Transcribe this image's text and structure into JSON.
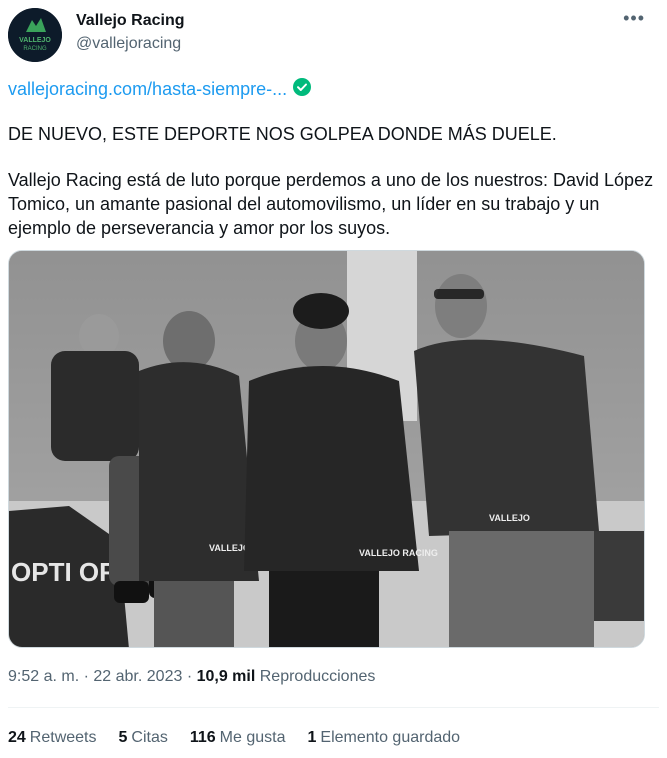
{
  "account": {
    "name": "Vallejo Racing",
    "handle": "@vallejoracing",
    "avatar_text": "VALLEJO RACING"
  },
  "tweet": {
    "link": "vallejoracing.com/hasta-siempre-...",
    "line1": "DE NUEVO, ESTE DEPORTE NOS GOLPEA DONDE MÁS DUELE.",
    "line2": "Vallejo Racing está de luto porque perdemos a uno de los nuestros: David López Tomico, un amante pasional del automovilismo, un líder en su trabajo y un ejemplo de perseverancia y amor por los suyos."
  },
  "meta": {
    "time": "9:52 a. m.",
    "date": "22 abr. 2023",
    "views_count": "10,9 mil",
    "views_label": "Reproducciones"
  },
  "stats": {
    "retweets_count": "24",
    "retweets_label": "Retweets",
    "quotes_count": "5",
    "quotes_label": "Citas",
    "likes_count": "116",
    "likes_label": "Me gusta",
    "bookmarks_count": "1",
    "bookmarks_label": "Elemento guardado"
  },
  "photo": {
    "jacket_text": "VALLEJO RACING",
    "car_text": "OPTI ORO"
  },
  "colors": {
    "link": "#1d9bf0",
    "verified": "#00ba7c",
    "secondary_text": "#536471",
    "primary_text": "#0f1419"
  },
  "icons": {
    "more": "more-horizontal-icon",
    "verified": "verified-check-icon"
  }
}
